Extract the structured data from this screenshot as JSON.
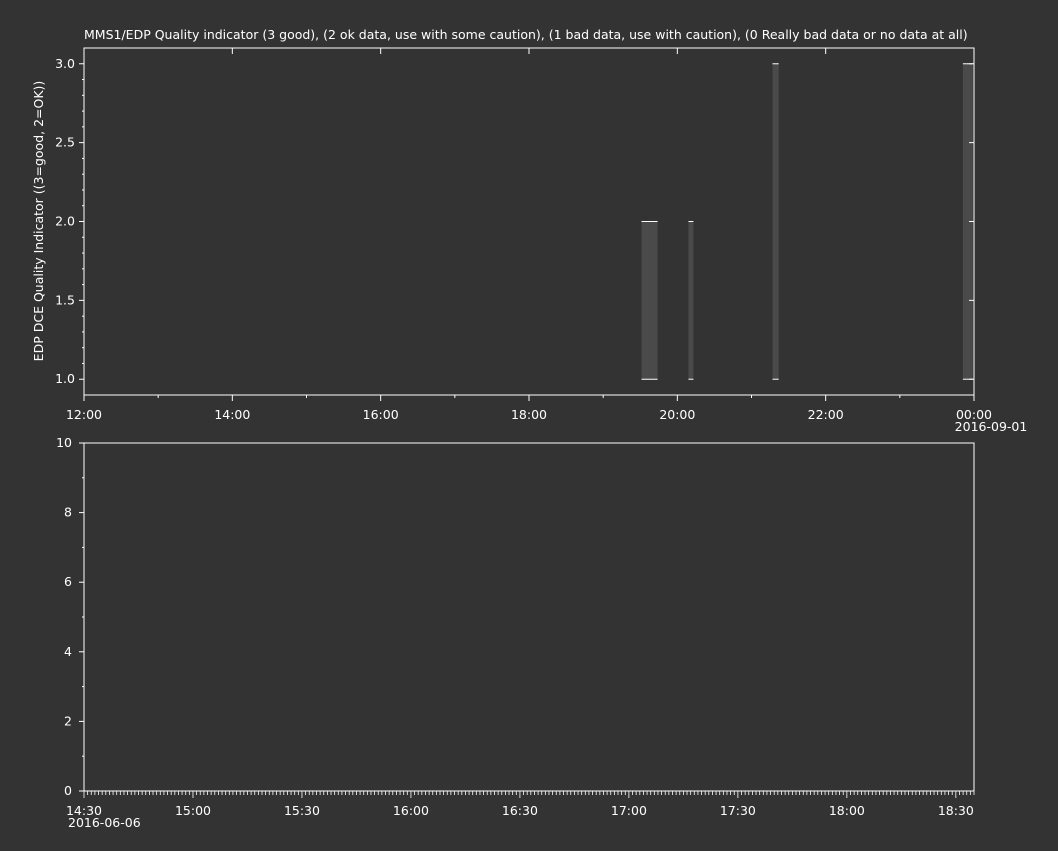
{
  "colors": {
    "background": "#333333",
    "foreground": "#ffffff",
    "bar": "#4a4a4a"
  },
  "chart_data": [
    {
      "type": "bar",
      "title": "MMS1/EDP  Quality indicator (3 good), (2 ok data, use with some caution), (1 bad data, use with caution), (0 Really bad data or no data at all)",
      "ylabel": "EDP DCE Quality Indicator ((3=good, 2=OK))",
      "xlabel": "",
      "ylim": [
        0.9,
        3.1
      ],
      "xlim_hours": [
        12,
        24
      ],
      "x_tick_labels": [
        "12:00",
        "14:00",
        "16:00",
        "18:00",
        "20:00",
        "22:00",
        "00:00"
      ],
      "x_tick_date": "2016-09-01",
      "y_tick_labels": [
        "1.0",
        "1.5",
        "2.0",
        "2.5",
        "3.0"
      ],
      "y_ticks": [
        1.0,
        1.5,
        2.0,
        2.5,
        3.0
      ],
      "segments": [
        {
          "x_start": "19:31",
          "x_end": "19:44",
          "y_low": 1,
          "y_high": 2
        },
        {
          "x_start": "20:09",
          "x_end": "20:13",
          "y_low": 1,
          "y_high": 2
        },
        {
          "x_start": "21:17",
          "x_end": "21:22",
          "y_low": 1,
          "y_high": 3
        },
        {
          "x_start": "23:51",
          "x_end": "23:59",
          "y_low": 1,
          "y_high": 3
        }
      ],
      "grid": false
    },
    {
      "type": "line",
      "title": "",
      "ylabel": "",
      "xlabel": "",
      "ylim": [
        0,
        10
      ],
      "y_ticks": [
        0,
        2,
        4,
        6,
        8,
        10
      ],
      "y_tick_labels": [
        "0",
        "2",
        "4",
        "6",
        "8",
        "10"
      ],
      "x_range": [
        "14:30",
        "18:35"
      ],
      "x_tick_labels": [
        "14:30",
        "15:00",
        "15:30",
        "16:00",
        "16:30",
        "17:00",
        "17:30",
        "18:00",
        "18:30"
      ],
      "x_tick_date": "2016-06-06",
      "series": [],
      "grid": false
    }
  ]
}
